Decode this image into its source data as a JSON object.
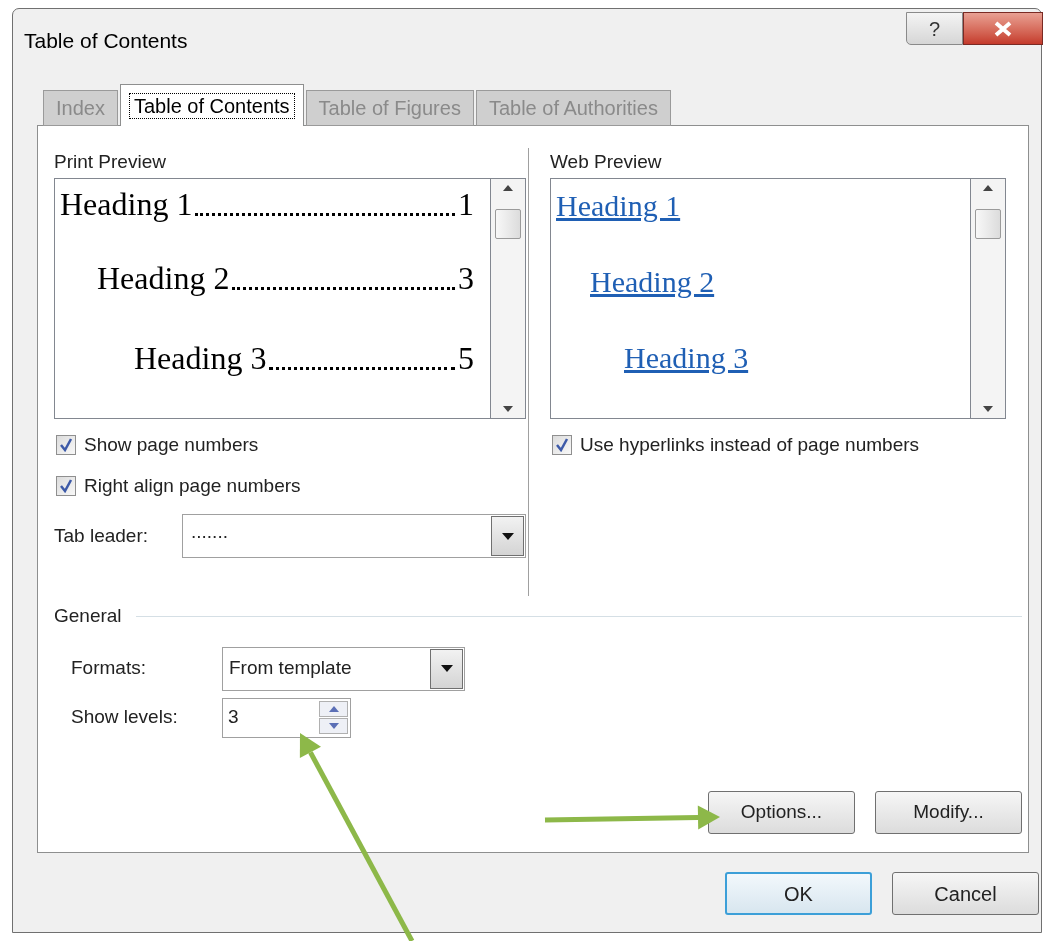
{
  "window": {
    "title": "Table of Contents",
    "help_label": "?"
  },
  "tabs": [
    {
      "label": "Index",
      "selected": false
    },
    {
      "label": "Table of Contents",
      "selected": true
    },
    {
      "label": "Table of Figures",
      "selected": false
    },
    {
      "label": "Table of Authorities",
      "selected": false
    }
  ],
  "print_preview": {
    "label": "Print Preview",
    "entries": [
      {
        "text": "Heading 1",
        "page": "1",
        "children": [
          {
            "text": "Heading 2",
            "page": "3",
            "children": [
              {
                "text": "Heading 3",
                "page": "5"
              }
            ]
          }
        ]
      }
    ]
  },
  "web_preview": {
    "label": "Web Preview",
    "entries": [
      {
        "text": "Heading 1",
        "children": [
          {
            "text": "Heading 2",
            "children": [
              {
                "text": "Heading 3"
              }
            ]
          }
        ]
      }
    ]
  },
  "left_options": [
    {
      "label": "Show page numbers",
      "checked": true
    },
    {
      "label": "Right align page numbers",
      "checked": true
    }
  ],
  "right_options": [
    {
      "label": "Use hyperlinks instead of page numbers",
      "checked": true
    }
  ],
  "tab_leader": {
    "label": "Tab leader:",
    "value": "......."
  },
  "general": {
    "label": "General",
    "formats": {
      "label": "Formats:",
      "value": "From template"
    },
    "show_levels": {
      "label": "Show levels:",
      "value": "3"
    }
  },
  "panel_buttons": [
    {
      "label": "Options..."
    },
    {
      "label": "Modify..."
    }
  ],
  "dialog_buttons": [
    {
      "label": "OK",
      "default": true
    },
    {
      "label": "Cancel",
      "default": false
    }
  ],
  "annotations": [
    {
      "kind": "arrow"
    },
    {
      "kind": "arrow"
    }
  ]
}
